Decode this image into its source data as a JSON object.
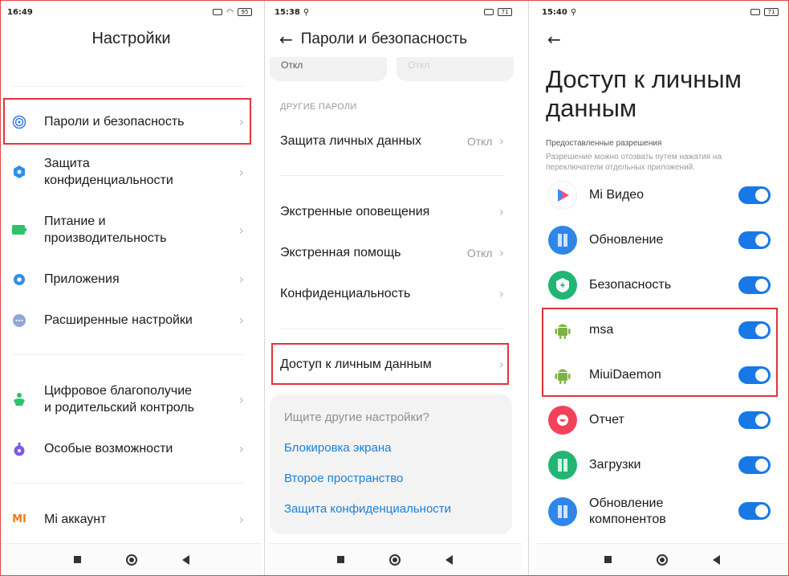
{
  "panel1": {
    "status": {
      "time": "16:49",
      "battery": "95"
    },
    "title": "Настройки",
    "items": [
      {
        "label": "Пароли и безопасность",
        "icon": "fingerprint-icon",
        "color": "#3b7be8"
      },
      {
        "label": "Защита\nконфиденциальности",
        "icon": "privacy-shield-icon",
        "color": "#2e8fe6"
      },
      {
        "label": "Питание и\nпроизводительность",
        "icon": "battery-icon",
        "color": "#2dc26b"
      },
      {
        "label": "Приложения",
        "icon": "gear-icon",
        "color": "#2d8fe6"
      },
      {
        "label": "Расширенные настройки",
        "icon": "more-dots-icon",
        "color": "#8fa7d6"
      },
      {
        "label": "Цифровое благополучие\nи родительский контроль",
        "icon": "wellbeing-icon",
        "color": "#2dc26b"
      },
      {
        "label": "Особые возможности",
        "icon": "accessibility-icon",
        "color": "#7b5ce6"
      },
      {
        "label": "Mi аккаунт",
        "icon": "mi-logo-icon",
        "color": "#f07a1a"
      }
    ],
    "mi_logo_text": "MI"
  },
  "panel2": {
    "status": {
      "time": "15:38",
      "battery": "71"
    },
    "title": "Пароли и безопасность",
    "pill_left": "Откл",
    "pill_right": "Откл",
    "section": "ДРУГИЕ ПАРОЛИ",
    "items": [
      {
        "label": "Защита личных данных",
        "value": "Откл"
      },
      {
        "label": "Экстренные оповещения",
        "value": ""
      },
      {
        "label": "Экстренная помощь",
        "value": "Откл"
      },
      {
        "label": "Конфиденциальность",
        "value": ""
      },
      {
        "label": "Доступ к личным данным",
        "value": ""
      }
    ],
    "search_card": {
      "question": "Ищите другие настройки?",
      "links": [
        "Блокировка экрана",
        "Второе пространство",
        "Защита конфиденциальности"
      ]
    }
  },
  "panel3": {
    "status": {
      "time": "15:40",
      "battery": "71"
    },
    "title": "Доступ к личным данным",
    "perm_header": "Предоставленные разрешения",
    "perm_desc": "Разрешение можно отозвать путем нажатия на переключатели отдельных приложений.",
    "apps": [
      {
        "name": "Mi Видео",
        "icon": "mi-video-icon",
        "enabled": true
      },
      {
        "name": "Обновление",
        "icon": "updater-icon",
        "enabled": true
      },
      {
        "name": "Безопасность",
        "icon": "security-icon",
        "enabled": true
      },
      {
        "name": "msa",
        "icon": "android-icon",
        "enabled": true
      },
      {
        "name": "MiuiDaemon",
        "icon": "android-icon",
        "enabled": true
      },
      {
        "name": "Отчет",
        "icon": "report-icon",
        "enabled": true
      },
      {
        "name": "Загрузки",
        "icon": "downloads-icon",
        "enabled": true
      },
      {
        "name": "Обновление\nкомпонентов",
        "icon": "component-updater-icon",
        "enabled": true
      }
    ]
  },
  "colors": {
    "accent": "#1778e6",
    "highlight": "#e0353a",
    "link": "#1a7fd9"
  }
}
